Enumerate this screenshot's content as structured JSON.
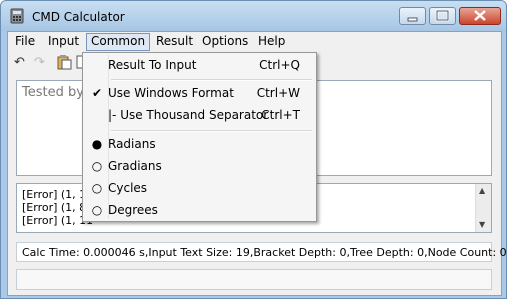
{
  "window": {
    "title": "CMD Calculator"
  },
  "menubar": {
    "items": [
      {
        "label": "File"
      },
      {
        "label": "Input"
      },
      {
        "label": "Common"
      },
      {
        "label": "Result"
      },
      {
        "label": "Options"
      },
      {
        "label": "Help"
      }
    ]
  },
  "input": {
    "text": "Tested by"
  },
  "results": {
    "lines": [
      "[Error] (1, 1...",
      "[Error] (1, 8...",
      "[Error] (1, 11"
    ]
  },
  "status": {
    "text": "Calc Time: 0.000046 s,Input Text Size: 19,Bracket Depth: 0,Tree Depth: 0,Node Count: 0"
  },
  "common_menu": {
    "items": [
      {
        "label": "Result To Input",
        "shortcut": "Ctrl+Q",
        "mark": ""
      },
      {
        "label": "Use Windows Format",
        "shortcut": "Ctrl+W",
        "mark": "✔"
      },
      {
        "label": "|- Use Thousand Separator",
        "shortcut": "Ctrl+T",
        "mark": ""
      },
      {
        "label": "Radians",
        "shortcut": "",
        "mark": "●"
      },
      {
        "label": "Gradians",
        "shortcut": "",
        "mark": "○"
      },
      {
        "label": "Cycles",
        "shortcut": "",
        "mark": "○"
      },
      {
        "label": "Degrees",
        "shortcut": "",
        "mark": "○"
      }
    ]
  },
  "icons": [
    "calculator-icon",
    "undo-icon",
    "redo-icon",
    "paste-icon",
    "copy-icon"
  ]
}
